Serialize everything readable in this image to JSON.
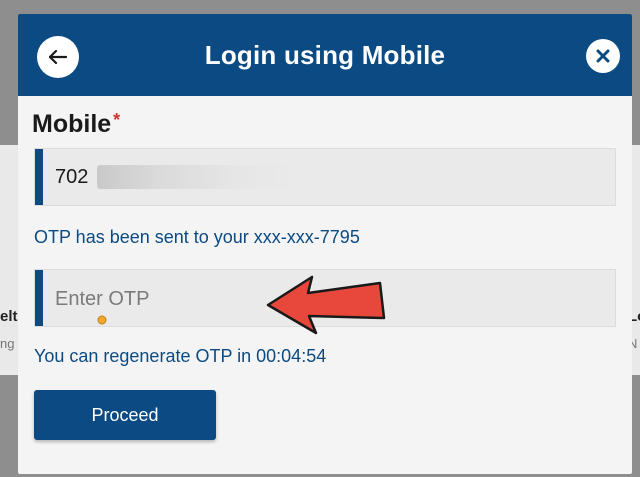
{
  "background": {
    "left_text": "elt",
    "left_subtext": "ng M",
    "right_text": "Lo",
    "right_subtext": "N"
  },
  "modal": {
    "title": "Login using Mobile",
    "back_icon": "arrow-left-icon",
    "close_icon": "close-icon"
  },
  "mobile": {
    "label": "Mobile",
    "required_mark": "*",
    "value": "702"
  },
  "status_message": "OTP has been sent to your xxx-xxx-7795",
  "otp": {
    "placeholder": "Enter OTP",
    "value": ""
  },
  "timer_message": "You can regenerate OTP in 00:04:54",
  "proceed_label": "Proceed",
  "colors": {
    "brand": "#0b4a82",
    "required": "#d32f2f",
    "arrow": "#e8473c"
  }
}
